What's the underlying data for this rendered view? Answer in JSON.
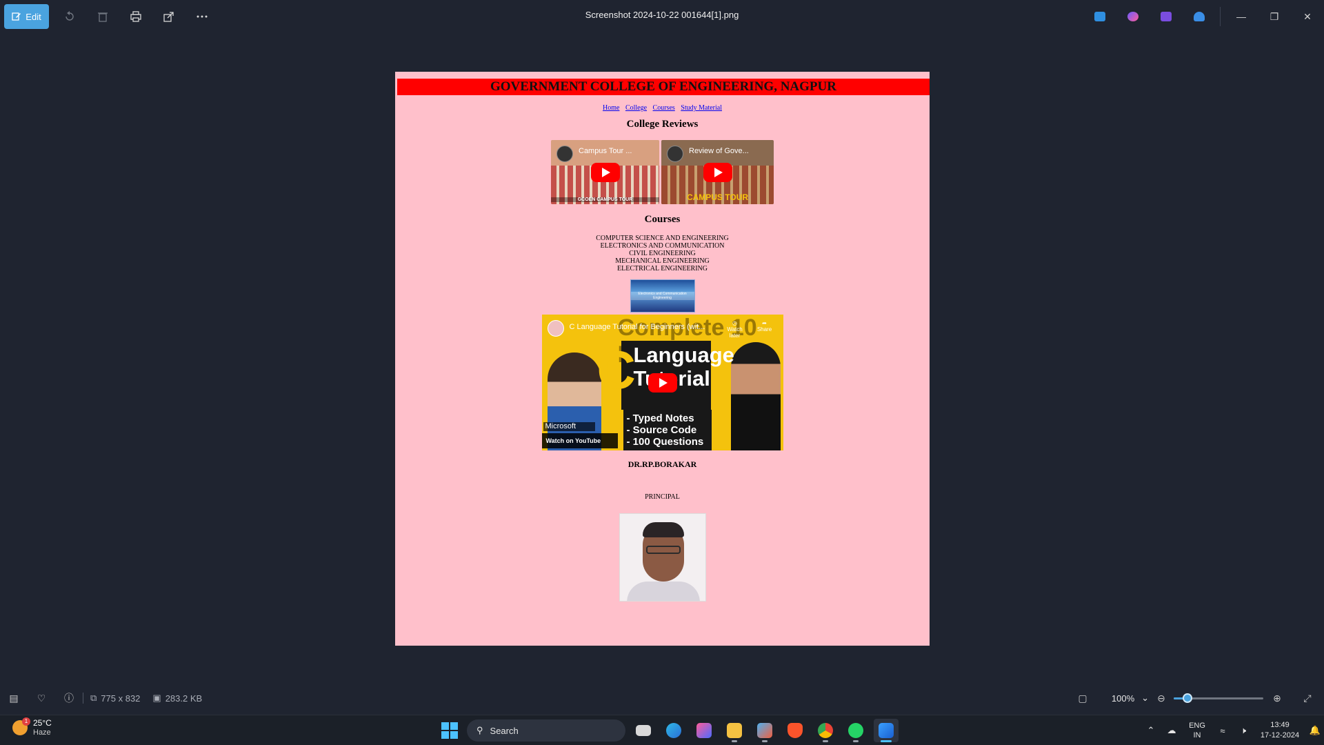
{
  "window": {
    "title": "Screenshot 2024-10-22 001644[1].png",
    "edit_label": "Edit"
  },
  "toolbar_icons": [
    "edit-icon",
    "rotate-icon",
    "delete-icon",
    "print-icon",
    "share-icon",
    "more-icon"
  ],
  "accent_color": "#4aa3df",
  "page": {
    "heading": "GOVERNMENT COLLEGE OF ENGINEERING, NAGPUR",
    "heading_bg": "#ff0000",
    "page_bg": "#ffc0cb",
    "nav": [
      "Home",
      "College",
      "Courses",
      "Study Material"
    ],
    "reviews_title": "College Reviews",
    "videos": [
      {
        "title": "Campus Tour ...",
        "caption": "GCOEN CAMPUS TOUR"
      },
      {
        "title": "Review of Gove...",
        "caption": "CAMPUS TOUR"
      }
    ],
    "courses_title": "Courses",
    "courses": [
      "COMPUTER SCIENCE AND ENGINEERING",
      "ELECTRONICS AND COMMUNICATION",
      "CIVIL ENGINEERING",
      "MECHANICAL ENGINEERING",
      "ELECTRICAL ENGINEERING"
    ],
    "small_image_text": "Electronics and Communication Engineering",
    "c_video": {
      "title": "C Language Tutorial for Beginners (wit...",
      "overlay": "Complete 10 Hour",
      "big_c": "C",
      "line1": "Language",
      "line2": "Tutorial",
      "notes": [
        "- Typed Notes",
        "- Source Code",
        "- 100 Questions"
      ],
      "watch_later": "Watch later",
      "share": "Share",
      "brand": "Microsoft",
      "watch_on": "Watch on YouTube"
    },
    "principal_name": "DR.RP.BORAKAR",
    "principal_role": "PRINCIPAL"
  },
  "status": {
    "dimensions": "775 x 832",
    "size": "283.2 KB",
    "zoom": "100%",
    "zoom_fraction": 0.1
  },
  "taskbar": {
    "weather_temp": "25°C",
    "weather_desc": "Haze",
    "weather_badge": "1",
    "search_label": "Search",
    "lang_line1": "ENG",
    "lang_line2": "IN",
    "time": "13:49",
    "date": "17-12-2024"
  }
}
